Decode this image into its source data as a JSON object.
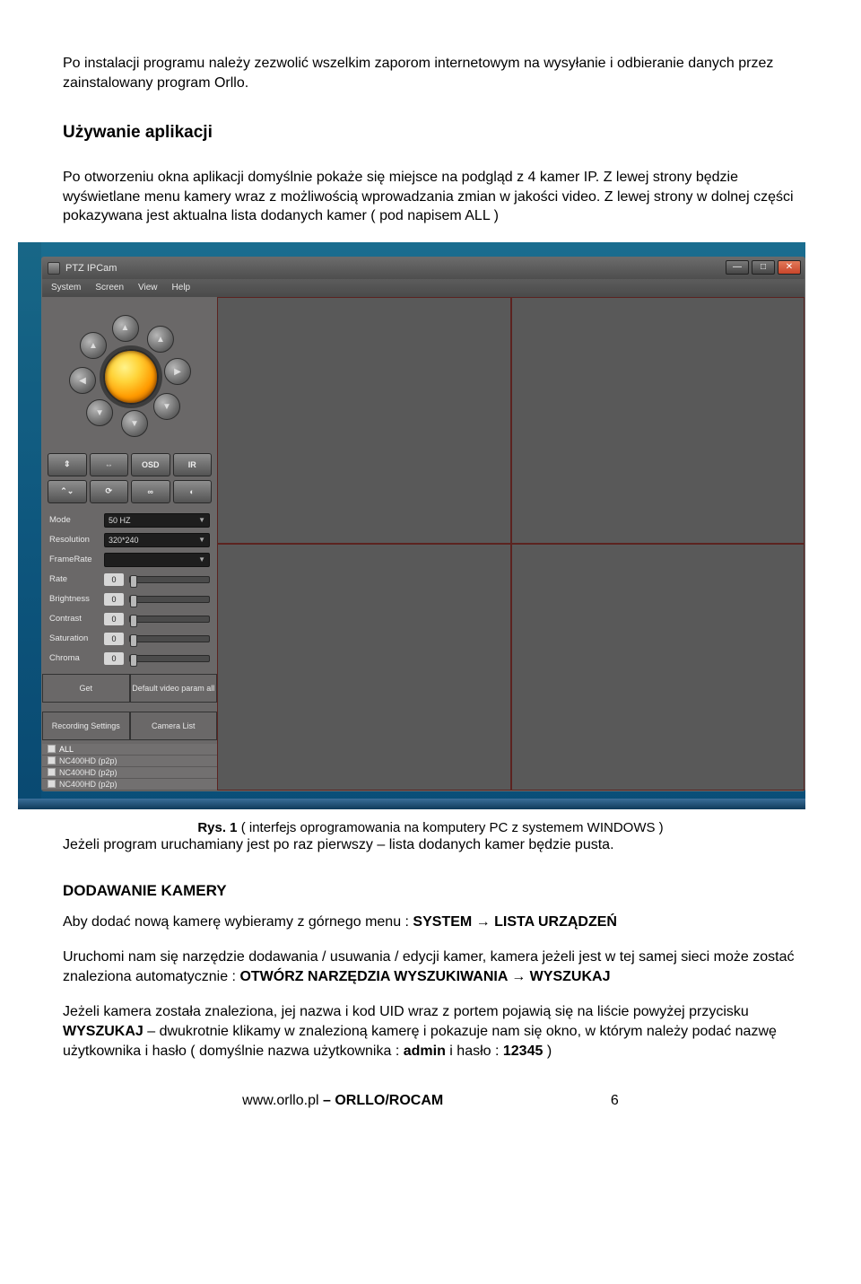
{
  "doc": {
    "p1": "Po instalacji programu należy zezwolić wszelkim zaporom internetowym na wysyłanie i odbieranie danych przez zainstalowany program Orllo.",
    "h1": "Używanie aplikacji",
    "p2": "Po otworzeniu okna aplikacji domyślnie pokaże się miejsce na podgląd z 4 kamer IP. Z lewej strony będzie wyświetlane menu kamery wraz z możliwością wprowadzania zmian w jakości video. Z lewej strony w dolnej części pokazywana jest aktualna lista dodanych kamer ( pod napisem ALL )",
    "caption_prefix": "Rys. 1",
    "caption_rest": " ( interfejs oprogramowania na komputery PC z systemem WINDOWS )",
    "p3": "Jeżeli program uruchamiany jest po raz pierwszy – lista dodanych kamer będzie pusta.",
    "h2": "DODAWANIE KAMERY",
    "p4_a": "Aby dodać nową kamerę wybieramy z górnego menu : ",
    "p4_b": "SYSTEM → LISTA URZĄDZEŃ",
    "p5_a": "Uruchomi nam się narzędzie dodawania / usuwania / edycji kamer, kamera jeżeli jest w tej samej sieci może zostać znaleziona automatycznie :  ",
    "p5_b": "OTWÓRZ NARZĘDZIA WYSZUKIWANIA → WYSZUKAJ",
    "p6_a": "Jeżeli kamera została znaleziona, jej nazwa i kod UID wraz z portem pojawią się na liście powyżej przycisku ",
    "p6_b": "WYSZUKAJ",
    "p6_c": " – dwukrotnie klikamy w znalezioną kamerę  i pokazuje nam się okno, w którym należy podać nazwę użytkownika i hasło ( domyślnie nazwa użytkownika : ",
    "p6_d": "admin",
    "p6_e": " i hasło : ",
    "p6_f": "12345",
    "p6_g": " )",
    "footer_a": "www.orllo.pl",
    "footer_b": "   – ORLLO/ROCAM",
    "footer_pg": "6"
  },
  "app": {
    "title": "PTZ IPCam",
    "menu": {
      "m0": "System",
      "m1": "Screen",
      "m2": "View",
      "m3": "Help"
    },
    "btns_row1": {
      "b0": "⇕",
      "b1": "⇔",
      "b2": "OSD",
      "b3": "IR"
    },
    "btns_row2": {
      "b0": "⌃⌄",
      "b1": "⟳",
      "b2": "∞",
      "b3": "◐"
    },
    "fields": {
      "mode_label": "Mode",
      "mode_val": "50 HZ",
      "res_label": "Resolution",
      "res_val": "320*240",
      "fr_label": "FrameRate",
      "rate_label": "Rate",
      "rate_val": "0",
      "bri_label": "Brightness",
      "bri_val": "0",
      "con_label": "Contrast",
      "con_val": "0",
      "sat_label": "Saturation",
      "sat_val": "0",
      "chr_label": "Chroma",
      "chr_val": "0",
      "get_label": "Get",
      "get_val": "Default video param all",
      "rec_label": "Recording Settings",
      "list_label": "Camera List"
    },
    "cams": {
      "all": "ALL",
      "c0": "NC400HD (p2p)",
      "c1": "NC400HD (p2p)",
      "c2": "NC400HD (p2p)"
    }
  }
}
